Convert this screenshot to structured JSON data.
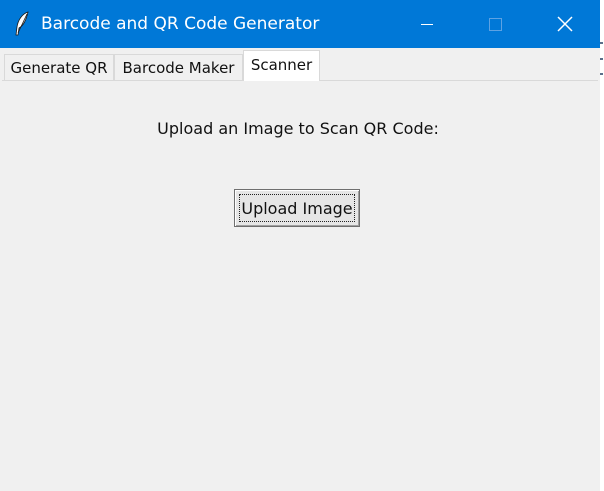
{
  "window": {
    "title": "Barcode and QR Code Generator",
    "titlebar_color": "#0078d7",
    "body_color": "#f0f0f0"
  },
  "icons": {
    "app": "feather-icon",
    "minimize": "minimize-icon",
    "maximize": "maximize-icon",
    "close": "close-icon"
  },
  "tabs": [
    {
      "label": "Generate QR",
      "selected": false
    },
    {
      "label": "Barcode Maker",
      "selected": false
    },
    {
      "label": "Scanner",
      "selected": true
    }
  ],
  "scanner": {
    "prompt": "Upload an Image to Scan QR Code:",
    "upload_label": "Upload Image"
  }
}
